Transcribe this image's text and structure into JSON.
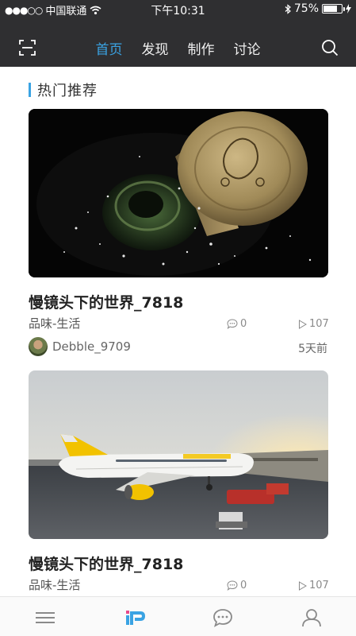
{
  "status_bar": {
    "signal": "●●●○○",
    "carrier": "中国联通",
    "time": "下午10:31",
    "battery": "75%",
    "battery_level": 0.75
  },
  "header": {
    "tabs": [
      {
        "label": "首页",
        "active": true
      },
      {
        "label": "发现",
        "active": false
      },
      {
        "label": "制作",
        "active": false
      },
      {
        "label": "讨论",
        "active": false
      }
    ],
    "accent_color": "#3aa3e3",
    "icons": {
      "left": "scan-icon",
      "right": "search-icon"
    }
  },
  "section": {
    "title": "热门推荐"
  },
  "cards": [
    {
      "title": "慢镜头下的世界_7818",
      "category": "品味-生活",
      "comments": "0",
      "plays": "107",
      "author": "Debble_9709",
      "time": "5天前",
      "image": "champagne-cork-image"
    },
    {
      "title": "慢镜头下的世界_7818",
      "category": "品味-生活",
      "comments": "0",
      "plays": "107",
      "image": "airplane-image"
    }
  ],
  "tabbar": {
    "icons": [
      "menu-icon",
      "logo-icon",
      "chat-icon",
      "profile-icon"
    ]
  }
}
